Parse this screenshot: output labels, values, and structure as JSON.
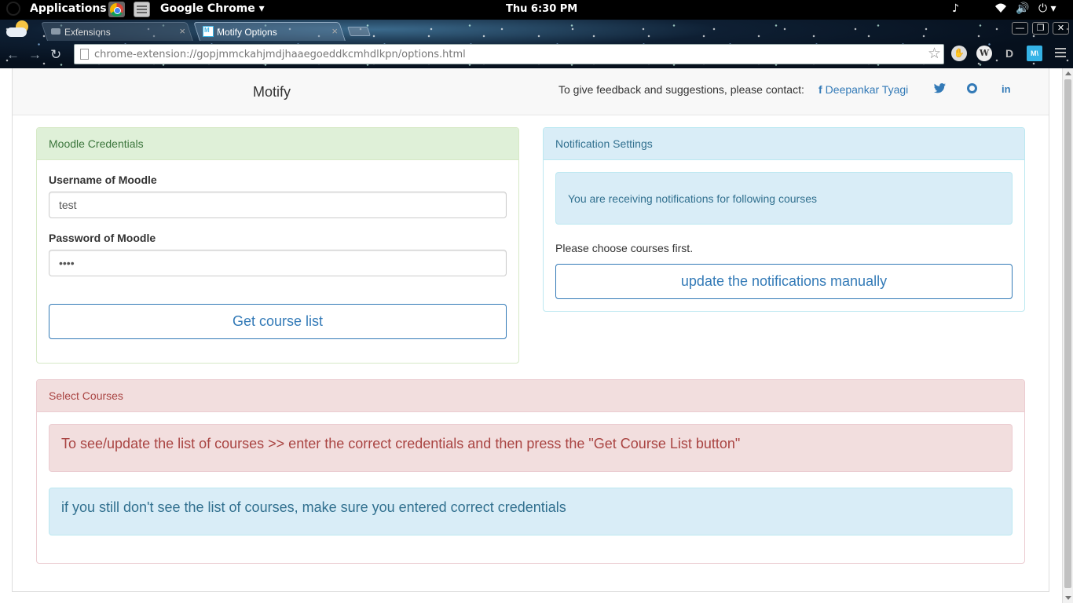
{
  "os_panel": {
    "applications_label": "Applications",
    "app_menu_label": "Google Chrome ▾",
    "clock": "Thu  6:30 PM",
    "music_icon": "♪",
    "wifi_icon": "wifi-icon",
    "volume_icon": "🔊",
    "power_icon": "⏻ ▾"
  },
  "browser": {
    "tabs": [
      {
        "title": "Extensions",
        "close": "×"
      },
      {
        "title": "Motify Options",
        "close": "×"
      }
    ],
    "window_buttons": {
      "minimize": "—",
      "maximize": "❐",
      "close": "✕"
    },
    "nav": {
      "back": "←",
      "forward": "→",
      "reload": "↻"
    },
    "url": "chrome-extension://gopjmmckahjmdjhaaegoeddkcmhdlkpn/options.html",
    "bookmark_star": "☆",
    "extensions": [
      "✋",
      "W",
      "D",
      "M\\"
    ]
  },
  "header": {
    "brand": "Motify",
    "contact_text": "To give feedback and suggestions, please contact:",
    "facebook_glyph": "f",
    "author_name": "Deepankar Tyagi",
    "twitter_glyph": "🐦",
    "linkedin_glyph": "in"
  },
  "credentials": {
    "heading": "Moodle Credentials",
    "username_label": "Username of Moodle",
    "username_value": "test",
    "password_label": "Password of Moodle",
    "password_value": "••••",
    "get_button": "Get course list"
  },
  "notifications": {
    "heading": "Notification Settings",
    "info_text": "You are receiving notifications for following courses",
    "choose_text": "Please choose courses first.",
    "update_button": "update the notifications manually"
  },
  "courses": {
    "heading": "Select Courses",
    "alert_danger": "To see/update the list of courses >> enter the correct credentials and then press the \"Get Course List button\"",
    "alert_info": "if you still don't see the list of courses, make sure you entered correct credentials"
  },
  "colors": {
    "link": "#337ab7",
    "success_bg": "#dff0d8",
    "info_bg": "#d9edf7",
    "danger_bg": "#f2dede"
  }
}
